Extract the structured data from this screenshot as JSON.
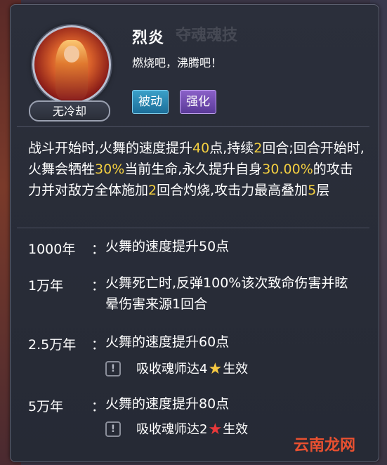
{
  "skill": {
    "name": "烈炎",
    "quote": "燃烧吧，沸腾吧！",
    "cooldown_label": "无冷却",
    "tags": [
      {
        "label": "被动",
        "color": "#2a88b8"
      },
      {
        "label": "强化",
        "color": "#7048b0"
      }
    ],
    "ghost_title": "夺魂魂技"
  },
  "description": {
    "segments": [
      {
        "text": "战斗开始时,火舞的速度提升",
        "hl": false
      },
      {
        "text": "40",
        "hl": true
      },
      {
        "text": "点,持续",
        "hl": false
      },
      {
        "text": "2",
        "hl": true
      },
      {
        "text": "回合;回合开始时,火舞会牺牲",
        "hl": false
      },
      {
        "text": "30%",
        "hl": true
      },
      {
        "text": "当前生命,永久提升自身",
        "hl": false
      },
      {
        "text": "30.00%",
        "hl": true
      },
      {
        "text": "的攻击力并对敌方全体施加",
        "hl": false
      },
      {
        "text": "2",
        "hl": true
      },
      {
        "text": "回合灼烧,攻击力最高叠加",
        "hl": false
      },
      {
        "text": "5",
        "hl": true
      },
      {
        "text": "层",
        "hl": false
      }
    ]
  },
  "upgrades": [
    {
      "level": "1000年",
      "colon": "：",
      "effect": "火舞的速度提升50点"
    },
    {
      "level": "1万年",
      "colon": "：",
      "effect": "火舞死亡时,反弹100%该次致命伤害并眩晕伤害来源1回合"
    },
    {
      "level": "2.5万年",
      "colon": "：",
      "effect": "火舞的速度提升60点",
      "requirement": {
        "icon": "exclamation-icon",
        "prefix": "吸收魂师达4",
        "star_color": "#f5c842",
        "suffix": "生效"
      }
    },
    {
      "level": "5万年",
      "colon": "：",
      "effect": "火舞的速度提升80点",
      "requirement": {
        "icon": "exclamation-icon",
        "prefix": "吸收魂师达2",
        "star_color": "#e8383a",
        "suffix": "生效"
      }
    }
  ],
  "watermark": "云南龙网",
  "colors": {
    "highlight": "#f5d040",
    "panel": "#2a2e38",
    "text": "#ffffff"
  }
}
